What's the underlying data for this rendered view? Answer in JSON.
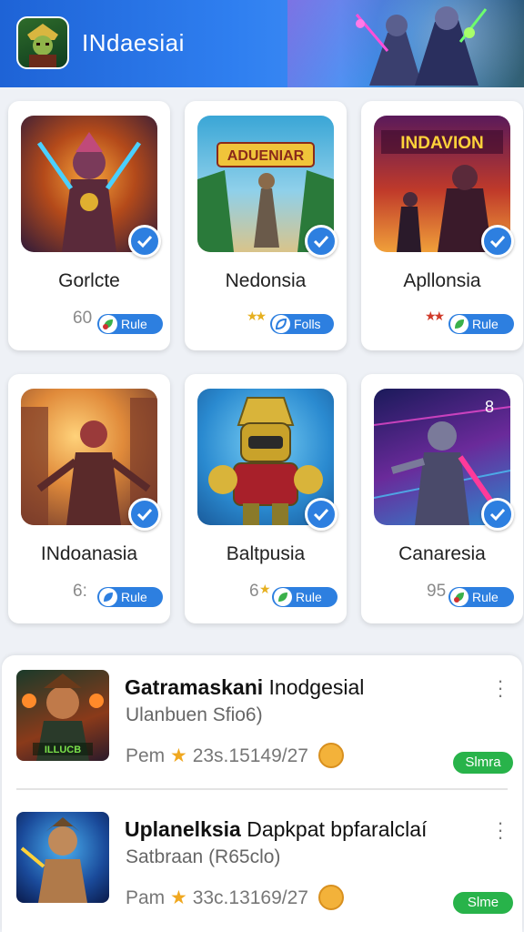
{
  "header": {
    "title": "INdaesiai",
    "logo_icon": "warrior-avatar-icon",
    "banner_art": "hero-characters-banner"
  },
  "cards": [
    {
      "name": "Gorlcte",
      "score": "60",
      "stars": "",
      "pill_label": "Rule",
      "verified": true,
      "thumb_colors": [
        "#3a1f4a",
        "#f08a2a"
      ]
    },
    {
      "name": "Nedonsia",
      "score": "",
      "stars": "★★",
      "pill_label": "Folls",
      "verified": true,
      "thumb_colors": [
        "#3aa6d6",
        "#e9d59b"
      ],
      "thumb_text": "ADUENIAR"
    },
    {
      "name": "Apllonsia",
      "score": "",
      "stars": "★★",
      "pill_label": "Rule",
      "verified": true,
      "thumb_colors": [
        "#4a1a2a",
        "#d24a2a"
      ],
      "thumb_text": "INDAVION"
    },
    {
      "name": "INdoanasia",
      "score": "6:",
      "stars": "",
      "pill_label": "Rule",
      "verified": true,
      "thumb_colors": [
        "#6a3a2a",
        "#f3b04a"
      ]
    },
    {
      "name": "Baltpusia",
      "score": "6",
      "stars": "★",
      "pill_label": "Rule",
      "verified": true,
      "thumb_colors": [
        "#1a8ad0",
        "#6ec4ef"
      ]
    },
    {
      "name": "Canaresia",
      "score": "95",
      "stars": "",
      "pill_label": "Rule",
      "verified": true,
      "thumb_colors": [
        "#1a1a4a",
        "#c03ac0"
      ],
      "corner_badge": "8"
    }
  ],
  "list": [
    {
      "title_bold": "Gatramaskani",
      "title_rest": " Inodgesial",
      "subtitle": "Ulanbuen Sfio6)",
      "meta_prefix": "Pem",
      "meta_value": "23s.15149/27",
      "tag": "Slmra",
      "thumb_text": "ILLUCB"
    },
    {
      "title_bold": "Uplanelksia",
      "title_rest": "  Dapkpat bpfaralclaí",
      "subtitle": "Satbraan (R65clo)",
      "meta_prefix": "Pam",
      "meta_value": "33c.13169/27",
      "tag": "Slme",
      "thumb_text": ""
    }
  ],
  "colors": {
    "accent_blue": "#2d7fe0",
    "tag_green": "#28b34a",
    "star_gold": "#f0a820"
  }
}
